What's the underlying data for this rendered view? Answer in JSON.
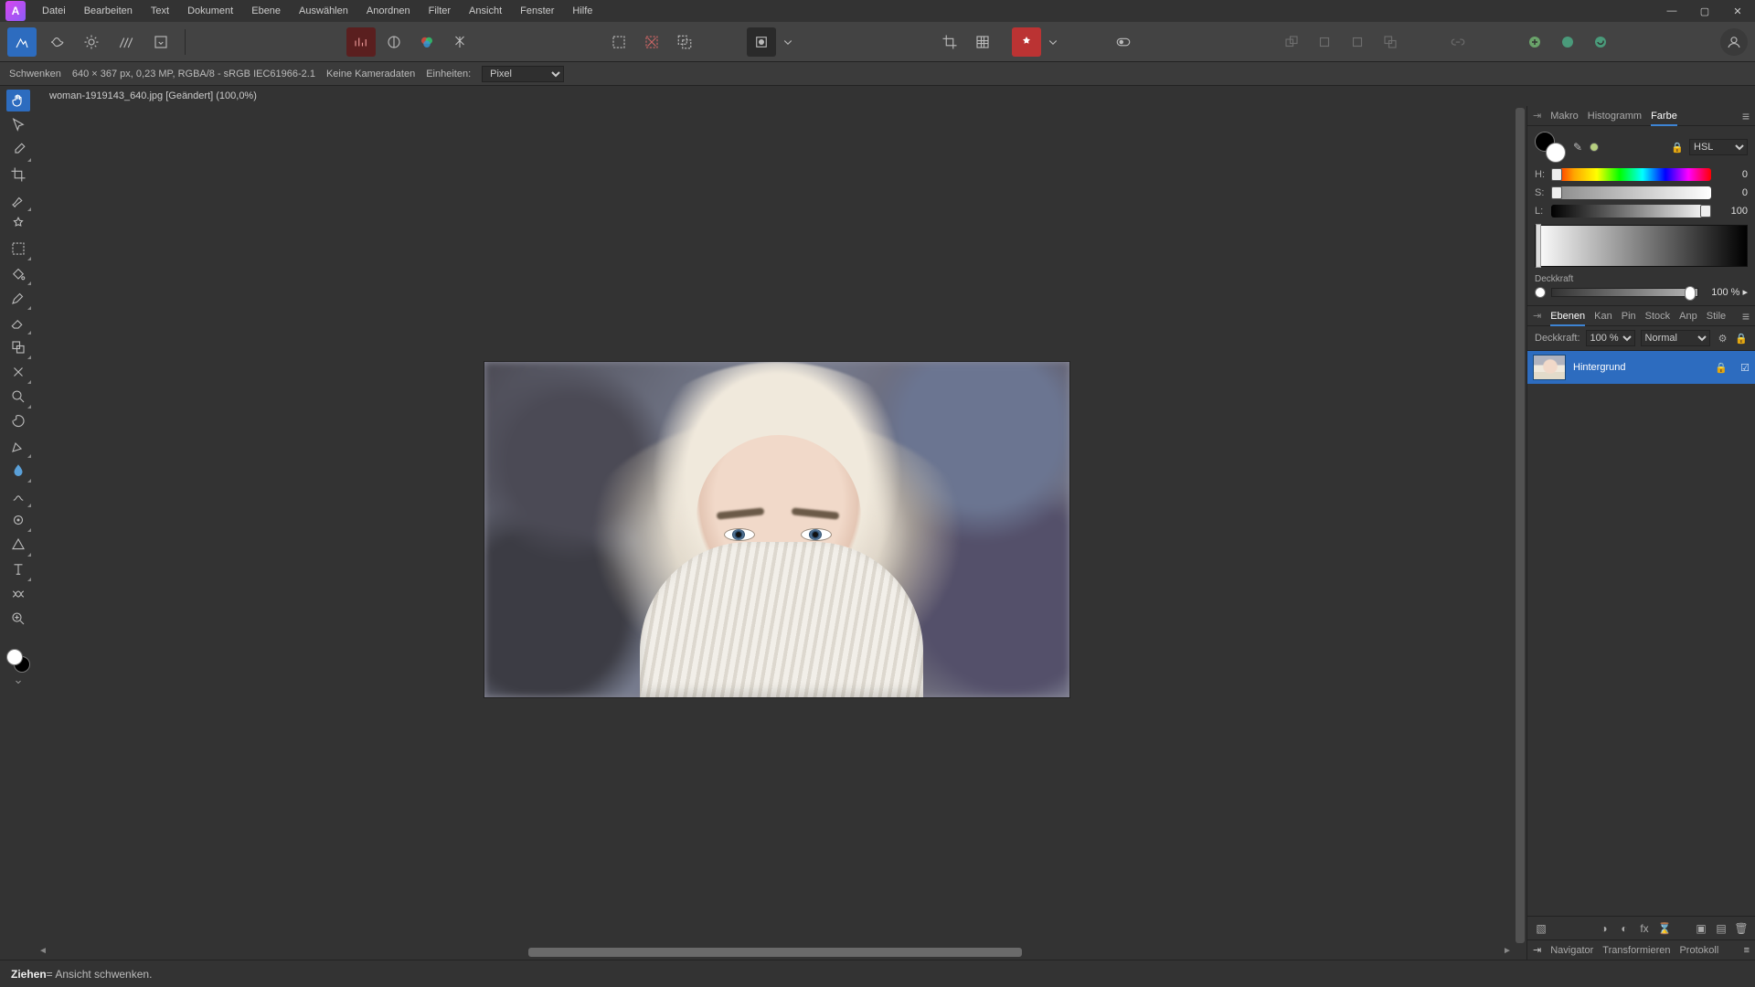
{
  "menubar": {
    "items": [
      "Datei",
      "Bearbeiten",
      "Text",
      "Dokument",
      "Ebene",
      "Auswählen",
      "Anordnen",
      "Filter",
      "Ansicht",
      "Fenster",
      "Hilfe"
    ]
  },
  "context": {
    "tool_name": "Schwenken",
    "doc_info": "640 × 367 px, 0,23 MP, RGBA/8 - sRGB IEC61966-2.1",
    "camera_data": "Keine Kameradaten",
    "units_label": "Einheiten:",
    "units_value": "Pixel"
  },
  "document": {
    "tab_title": "woman-1919143_640.jpg [Geändert] (100,0%)"
  },
  "right": {
    "top_tabs": [
      "Makro",
      "Histogramm",
      "Farbe"
    ],
    "top_active": 2,
    "mid_tabs": [
      "Ebenen",
      "Kan",
      "Pin",
      "Stock",
      "Anp",
      "Stile"
    ],
    "mid_active": 0,
    "bottom_tabs": [
      "Navigator",
      "Transformieren",
      "Protokoll"
    ]
  },
  "color": {
    "mode": "HSL",
    "h": 0,
    "s": 0,
    "l": 100,
    "opacity_label": "Deckkraft",
    "opacity": "100 %"
  },
  "layers": {
    "opacity_label": "Deckkraft:",
    "opacity": "100 %",
    "blend": "Normal",
    "rows": [
      {
        "name": "Hintergrund"
      }
    ]
  },
  "status": {
    "action": "Ziehen",
    "hint": " = Ansicht schwenken."
  },
  "labels": {
    "H": "H:",
    "S": "S:",
    "L": "L:"
  }
}
